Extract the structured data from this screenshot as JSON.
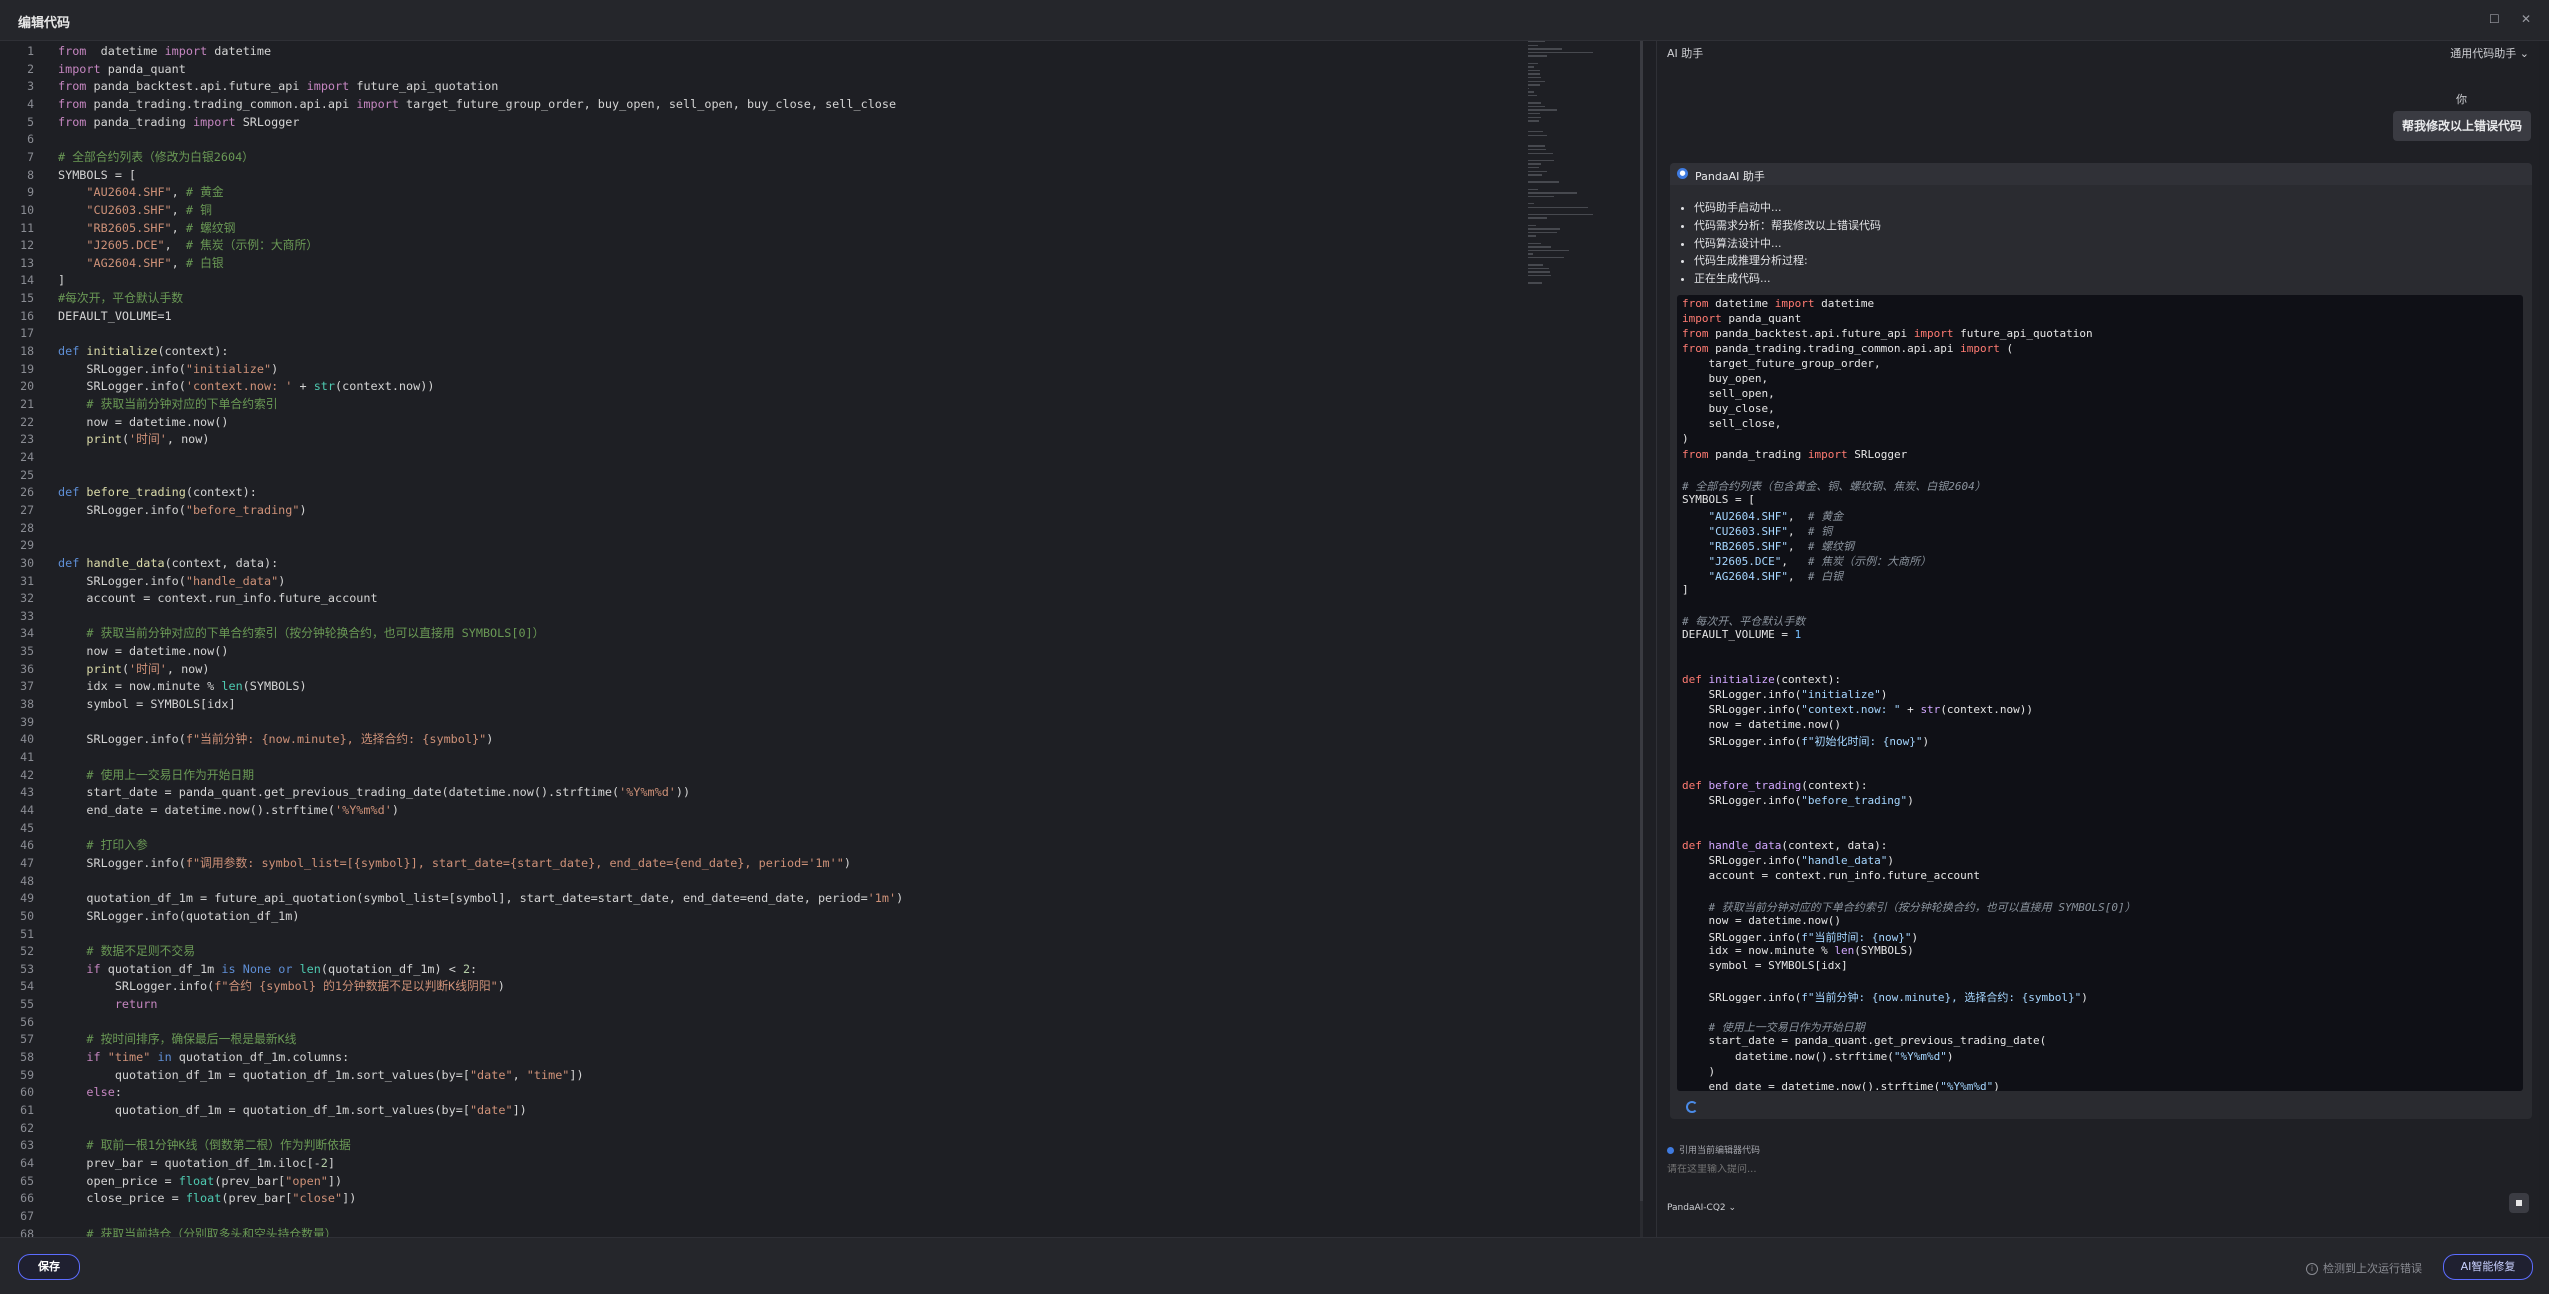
{
  "window": {
    "title": "编辑代码",
    "maximize_glyph": "☐",
    "close_glyph": "✕"
  },
  "editor": {
    "active_line": 29,
    "lines": [
      [
        [
          "kp",
          "from"
        ],
        [
          "",
          "  datetime "
        ],
        [
          "kp",
          "import"
        ],
        [
          "",
          " datetime"
        ]
      ],
      [
        [
          "kp",
          "import"
        ],
        [
          "",
          " panda_quant"
        ]
      ],
      [
        [
          "kp",
          "from"
        ],
        [
          "",
          " panda_backtest.api.future_api "
        ],
        [
          "kp",
          "import"
        ],
        [
          "",
          " future_api_quotation"
        ]
      ],
      [
        [
          "kp",
          "from"
        ],
        [
          "",
          " panda_trading.trading_common.api.api "
        ],
        [
          "kp",
          "import"
        ],
        [
          "",
          " target_future_group_order, buy_open, sell_open, buy_close, sell_close"
        ]
      ],
      [
        [
          "kp",
          "from"
        ],
        [
          "",
          " panda_trading "
        ],
        [
          "kp",
          "import"
        ],
        [
          "",
          " SRLogger"
        ]
      ],
      [],
      [
        [
          "cm",
          "# 全部合约列表（修改为白银2604）"
        ]
      ],
      [
        [
          "",
          "SYMBOLS = ["
        ]
      ],
      [
        [
          "",
          "    "
        ],
        [
          "str",
          "\"AU2604.SHF\""
        ],
        [
          "",
          ", "
        ],
        [
          "cm",
          "# 黄金"
        ]
      ],
      [
        [
          "",
          "    "
        ],
        [
          "str",
          "\"CU2603.SHF\""
        ],
        [
          "",
          ", "
        ],
        [
          "cm",
          "# 铜"
        ]
      ],
      [
        [
          "",
          "    "
        ],
        [
          "str",
          "\"RB2605.SHF\""
        ],
        [
          "",
          ", "
        ],
        [
          "cm",
          "# 螺纹钢"
        ]
      ],
      [
        [
          "",
          "    "
        ],
        [
          "str",
          "\"J2605.DCE\""
        ],
        [
          "",
          ",  "
        ],
        [
          "cm",
          "# 焦炭（示例：大商所）"
        ]
      ],
      [
        [
          "",
          "    "
        ],
        [
          "str",
          "\"AG2604.SHF\""
        ],
        [
          "",
          ", "
        ],
        [
          "cm",
          "# 白银"
        ]
      ],
      [
        [
          "",
          "]"
        ]
      ],
      [
        [
          "cm",
          "#每次开，平仓默认手数"
        ]
      ],
      [
        [
          "",
          "DEFAULT_VOLUME=1"
        ]
      ],
      [],
      [
        [
          "kw",
          "def"
        ],
        [
          "",
          " "
        ],
        [
          "fn",
          "initialize"
        ],
        [
          "",
          "(context):"
        ]
      ],
      [
        [
          "",
          "    SRLogger.info("
        ],
        [
          "str",
          "\"initialize\""
        ],
        [
          "",
          ")"
        ]
      ],
      [
        [
          "",
          "    SRLogger.info("
        ],
        [
          "str",
          "'context.now: '"
        ],
        [
          "",
          " + "
        ],
        [
          "bi",
          "str"
        ],
        [
          "",
          "(context.now))"
        ]
      ],
      [
        [
          "",
          "    "
        ],
        [
          "cm",
          "# 获取当前分钟对应的下单合约索引"
        ]
      ],
      [
        [
          "",
          "    now = datetime.now()"
        ]
      ],
      [
        [
          "",
          "    "
        ],
        [
          "fn",
          "print"
        ],
        [
          "",
          "("
        ],
        [
          "str",
          "'时间'"
        ],
        [
          "",
          ", now)"
        ]
      ],
      [],
      [],
      [
        [
          "kw",
          "def"
        ],
        [
          "",
          " "
        ],
        [
          "fn",
          "before_trading"
        ],
        [
          "",
          "(context):"
        ]
      ],
      [
        [
          "",
          "    SRLogger.info("
        ],
        [
          "str",
          "\"before_trading\""
        ],
        [
          "",
          ")"
        ]
      ],
      [],
      [],
      [
        [
          "kw",
          "def"
        ],
        [
          "",
          " "
        ],
        [
          "fn",
          "handle_data"
        ],
        [
          "",
          "(context, data):"
        ]
      ],
      [
        [
          "",
          "    SRLogger.info("
        ],
        [
          "str",
          "\"handle_data\""
        ],
        [
          "",
          ")"
        ]
      ],
      [
        [
          "",
          "    account = context.run_info.future_account"
        ]
      ],
      [],
      [
        [
          "",
          "    "
        ],
        [
          "cm",
          "# 获取当前分钟对应的下单合约索引（按分钟轮换合约，也可以直接用 SYMBOLS[0]）"
        ]
      ],
      [
        [
          "",
          "    now = datetime.now()"
        ]
      ],
      [
        [
          "",
          "    "
        ],
        [
          "fn",
          "print"
        ],
        [
          "",
          "("
        ],
        [
          "str",
          "'时间'"
        ],
        [
          "",
          ", now)"
        ]
      ],
      [
        [
          "",
          "    idx = now.minute % "
        ],
        [
          "bi",
          "len"
        ],
        [
          "",
          "(SYMBOLS)"
        ]
      ],
      [
        [
          "",
          "    symbol = SYMBOLS[idx]"
        ]
      ],
      [],
      [
        [
          "",
          "    SRLogger.info("
        ],
        [
          "str",
          "f\"当前分钟: {now.minute}, 选择合约: {symbol}\""
        ],
        [
          "",
          ")"
        ]
      ],
      [],
      [
        [
          "",
          "    "
        ],
        [
          "cm",
          "# 使用上一交易日作为开始日期"
        ]
      ],
      [
        [
          "",
          "    start_date = panda_quant.get_previous_trading_date(datetime.now().strftime("
        ],
        [
          "str",
          "'%Y%m%d'"
        ],
        [
          "",
          "))"
        ]
      ],
      [
        [
          "",
          "    end_date = datetime.now().strftime("
        ],
        [
          "str",
          "'%Y%m%d'"
        ],
        [
          "",
          ")"
        ]
      ],
      [],
      [
        [
          "",
          "    "
        ],
        [
          "cm",
          "# 打印入参"
        ]
      ],
      [
        [
          "",
          "    SRLogger.info("
        ],
        [
          "str",
          "f\"调用参数: symbol_list=[{symbol}], start_date={start_date}, end_date={end_date}, period='1m'\""
        ],
        [
          "",
          ")"
        ]
      ],
      [],
      [
        [
          "",
          "    quotation_df_1m = future_api_quotation(symbol_list=[symbol], start_date=start_date, end_date=end_date, period="
        ],
        [
          "str",
          "'1m'"
        ],
        [
          "",
          ")"
        ]
      ],
      [
        [
          "",
          "    SRLogger.info(quotation_df_1m)"
        ]
      ],
      [],
      [
        [
          "",
          "    "
        ],
        [
          "cm",
          "# 数据不足则不交易"
        ]
      ],
      [
        [
          "",
          "    "
        ],
        [
          "kp",
          "if"
        ],
        [
          "",
          " quotation_df_1m "
        ],
        [
          "kw",
          "is"
        ],
        [
          "",
          " "
        ],
        [
          "kw",
          "None"
        ],
        [
          "",
          " "
        ],
        [
          "kw",
          "or"
        ],
        [
          "",
          " "
        ],
        [
          "bi",
          "len"
        ],
        [
          "",
          "(quotation_df_1m) < "
        ],
        [
          "num",
          "2"
        ],
        [
          "",
          ":"
        ]
      ],
      [
        [
          "",
          "        SRLogger.info("
        ],
        [
          "str",
          "f\"合约 {symbol} 的1分钟数据不足以判断K线阴阳\""
        ],
        [
          "",
          ")"
        ]
      ],
      [
        [
          "",
          "        "
        ],
        [
          "kp",
          "return"
        ]
      ],
      [],
      [
        [
          "",
          "    "
        ],
        [
          "cm",
          "# 按时间排序，确保最后一根是最新K线"
        ]
      ],
      [
        [
          "",
          "    "
        ],
        [
          "kp",
          "if"
        ],
        [
          "",
          " "
        ],
        [
          "str",
          "\"time\""
        ],
        [
          "",
          " "
        ],
        [
          "kw",
          "in"
        ],
        [
          "",
          " quotation_df_1m.columns:"
        ]
      ],
      [
        [
          "",
          "        quotation_df_1m = quotation_df_1m.sort_values(by=["
        ],
        [
          "str",
          "\"date\""
        ],
        [
          "",
          ", "
        ],
        [
          "str",
          "\"time\""
        ],
        [
          "",
          "])"
        ]
      ],
      [
        [
          "",
          "    "
        ],
        [
          "kp",
          "else"
        ],
        [
          "",
          ":"
        ]
      ],
      [
        [
          "",
          "        quotation_df_1m = quotation_df_1m.sort_values(by=["
        ],
        [
          "str",
          "\"date\""
        ],
        [
          "",
          "])"
        ]
      ],
      [],
      [
        [
          "",
          "    "
        ],
        [
          "cm",
          "# 取前一根1分钟K线（倒数第二根）作为判断依据"
        ]
      ],
      [
        [
          "",
          "    prev_bar = quotation_df_1m.iloc[-"
        ],
        [
          "num",
          "2"
        ],
        [
          "",
          "]"
        ]
      ],
      [
        [
          "",
          "    open_price = "
        ],
        [
          "bi",
          "float"
        ],
        [
          "",
          "(prev_bar["
        ],
        [
          "str",
          "\"open\""
        ],
        [
          "",
          "])"
        ]
      ],
      [
        [
          "",
          "    close_price = "
        ],
        [
          "bi",
          "float"
        ],
        [
          "",
          "(prev_bar["
        ],
        [
          "str",
          "\"close\""
        ],
        [
          "",
          "])"
        ]
      ],
      [],
      [
        [
          "",
          "    "
        ],
        [
          "cm",
          "# 获取当前持仓（分别取多头和空头持仓数量）"
        ]
      ]
    ]
  },
  "ai_panel": {
    "title": "AI 助手",
    "mode": "通用代码助手 ⌄",
    "user_label": "你",
    "user_message": "帮我修改以上错误代码",
    "bot_name": "PandaAI 助手",
    "bot_icon": "robot-icon",
    "steps": [
      "代码助手启动中...",
      "代码需求分析：帮我修改以上错误代码",
      "代码算法设计中...",
      "代码生成推理分析过程:",
      "正在生成代码..."
    ],
    "code_lines": [
      [
        [
          "rkw",
          "from"
        ],
        [
          "",
          " datetime "
        ],
        [
          "rkw",
          "import"
        ],
        [
          "",
          " datetime"
        ]
      ],
      [
        [
          "rkw",
          "import"
        ],
        [
          "",
          " panda_quant"
        ]
      ],
      [
        [
          "rkw",
          "from"
        ],
        [
          "",
          " panda_backtest.api.future_api "
        ],
        [
          "rkw",
          "import"
        ],
        [
          "",
          " future_api_quotation"
        ]
      ],
      [
        [
          "rkw",
          "from"
        ],
        [
          "",
          " panda_trading.trading_common.api.api "
        ],
        [
          "rkw",
          "import"
        ],
        [
          "",
          " ("
        ]
      ],
      [
        [
          "",
          "    target_future_group_order,"
        ]
      ],
      [
        [
          "",
          "    buy_open,"
        ]
      ],
      [
        [
          "",
          "    sell_open,"
        ]
      ],
      [
        [
          "",
          "    buy_close,"
        ]
      ],
      [
        [
          "",
          "    sell_close,"
        ]
      ],
      [
        [
          "",
          ")"
        ]
      ],
      [
        [
          "rkw",
          "from"
        ],
        [
          "",
          " panda_trading "
        ],
        [
          "rkw",
          "import"
        ],
        [
          "",
          " SRLogger"
        ]
      ],
      [],
      [
        [
          "rcm",
          "# 全部合约列表（包含黄金、铜、螺纹钢、焦炭、白银2604）"
        ]
      ],
      [
        [
          "",
          "SYMBOLS = ["
        ]
      ],
      [
        [
          "",
          "    "
        ],
        [
          "rstr",
          "\"AU2604.SHF\""
        ],
        [
          "",
          ",  "
        ],
        [
          "rcm",
          "# 黄金"
        ]
      ],
      [
        [
          "",
          "    "
        ],
        [
          "rstr",
          "\"CU2603.SHF\""
        ],
        [
          "",
          ",  "
        ],
        [
          "rcm",
          "# 铜"
        ]
      ],
      [
        [
          "",
          "    "
        ],
        [
          "rstr",
          "\"RB2605.SHF\""
        ],
        [
          "",
          ",  "
        ],
        [
          "rcm",
          "# 螺纹钢"
        ]
      ],
      [
        [
          "",
          "    "
        ],
        [
          "rstr",
          "\"J2605.DCE\""
        ],
        [
          "",
          ",   "
        ],
        [
          "rcm",
          "# 焦炭（示例：大商所）"
        ]
      ],
      [
        [
          "",
          "    "
        ],
        [
          "rstr",
          "\"AG2604.SHF\""
        ],
        [
          "",
          ",  "
        ],
        [
          "rcm",
          "# 白银"
        ]
      ],
      [
        [
          "",
          "]"
        ]
      ],
      [],
      [
        [
          "rcm",
          "# 每次开、平仓默认手数"
        ]
      ],
      [
        [
          "",
          "DEFAULT_VOLUME = "
        ],
        [
          "rnum",
          "1"
        ]
      ],
      [],
      [],
      [
        [
          "rkw",
          "def"
        ],
        [
          "",
          " "
        ],
        [
          "rfn",
          "initialize"
        ],
        [
          "",
          "(context):"
        ]
      ],
      [
        [
          "",
          "    SRLogger.info("
        ],
        [
          "rstr",
          "\"initialize\""
        ],
        [
          "",
          ")"
        ]
      ],
      [
        [
          "",
          "    SRLogger.info("
        ],
        [
          "rstr",
          "\"context.now: \""
        ],
        [
          "",
          " + "
        ],
        [
          "rfn",
          "str"
        ],
        [
          "",
          "(context.now))"
        ]
      ],
      [
        [
          "",
          "    now = datetime.now()"
        ]
      ],
      [
        [
          "",
          "    SRLogger.info("
        ],
        [
          "rstr",
          "f\"初始化时间: {now}\""
        ],
        [
          "",
          ")"
        ]
      ],
      [],
      [],
      [
        [
          "rkw",
          "def"
        ],
        [
          "",
          " "
        ],
        [
          "rfn",
          "before_trading"
        ],
        [
          "",
          "(context):"
        ]
      ],
      [
        [
          "",
          "    SRLogger.info("
        ],
        [
          "rstr",
          "\"before_trading\""
        ],
        [
          "",
          ")"
        ]
      ],
      [],
      [],
      [
        [
          "rkw",
          "def"
        ],
        [
          "",
          " "
        ],
        [
          "rfn",
          "handle_data"
        ],
        [
          "",
          "(context, data):"
        ]
      ],
      [
        [
          "",
          "    SRLogger.info("
        ],
        [
          "rstr",
          "\"handle_data\""
        ],
        [
          "",
          ")"
        ]
      ],
      [
        [
          "",
          "    account = context.run_info.future_account"
        ]
      ],
      [],
      [
        [
          "",
          "    "
        ],
        [
          "rcm",
          "# 获取当前分钟对应的下单合约索引（按分钟轮换合约，也可以直接用 SYMBOLS[0]）"
        ]
      ],
      [
        [
          "",
          "    now = datetime.now()"
        ]
      ],
      [
        [
          "",
          "    SRLogger.info("
        ],
        [
          "rstr",
          "f\"当前时间: {now}\""
        ],
        [
          "",
          ")"
        ]
      ],
      [
        [
          "",
          "    idx = now.minute % "
        ],
        [
          "rfn",
          "len"
        ],
        [
          "",
          "(SYMBOLS)"
        ]
      ],
      [
        [
          "",
          "    symbol = SYMBOLS[idx]"
        ]
      ],
      [],
      [
        [
          "",
          "    SRLogger.info("
        ],
        [
          "rstr",
          "f\"当前分钟: {now.minute}, 选择合约: {symbol}\""
        ],
        [
          "",
          ")"
        ]
      ],
      [],
      [
        [
          "",
          "    "
        ],
        [
          "rcm",
          "# 使用上一交易日作为开始日期"
        ]
      ],
      [
        [
          "",
          "    start_date = panda_quant.get_previous_trading_date("
        ]
      ],
      [
        [
          "",
          "        datetime.now().strftime("
        ],
        [
          "rstr",
          "\"%Y%m%d\""
        ],
        [
          "",
          ")"
        ]
      ],
      [
        [
          "",
          "    )"
        ]
      ],
      [
        [
          "",
          "    end_date = datetime.now().strftime("
        ],
        [
          "rstr",
          "\"%Y%m%d\""
        ],
        [
          "",
          ")"
        ]
      ]
    ],
    "reference_label": "引用当前编辑器代码",
    "prompt_placeholder": "请在这里输入提问...",
    "model_label": "PandaAI-CQ2 ⌄"
  },
  "footer": {
    "save_label": "保存",
    "error_note": "检测到上次运行错误",
    "error_icon": "info-icon",
    "fix_label": "AI智能修复"
  }
}
